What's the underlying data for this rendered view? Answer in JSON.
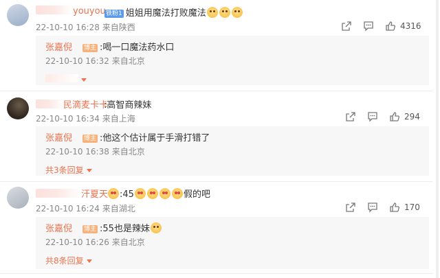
{
  "comments": [
    {
      "user_visible": "youyou",
      "badge": "铁粉1",
      "text": "姐姐用魔法打败魔法",
      "time": "22-10-10 16:28",
      "location": "来自陕西",
      "likes": "4316",
      "reply": {
        "user": "张嘉倪",
        "badge": "博主",
        "text": "喝一口魔法药水口",
        "time": "22-10-10 16:32",
        "location": "来自北京"
      }
    },
    {
      "user_visible": "民滴麦卡卡",
      "text": "高智商辣妹",
      "time": "22-10-10 16:34",
      "location": "来自上海",
      "likes": "294",
      "reply": {
        "user": "张嘉倪",
        "badge": "博主",
        "text": "他这个估计属于手滑打错了",
        "time": "22-10-10 16:38",
        "location": "来自北京"
      },
      "more_replies": "共3条回复"
    },
    {
      "user_visible": "汗夏天",
      "text_pre": "45",
      "text_post": "假的吧",
      "time": "22-10-10 16:24",
      "location": "来自湖北",
      "likes": "170",
      "reply": {
        "user": "张嘉倪",
        "badge": "博主",
        "text": "55也是辣妹",
        "time": "22-10-10 16:26",
        "location": "来自北京"
      },
      "more_replies": "共8条回复"
    }
  ],
  "colors": {
    "accent": "#eb7350",
    "meta": "#888888",
    "reply_bg": "#f7f7f7"
  }
}
